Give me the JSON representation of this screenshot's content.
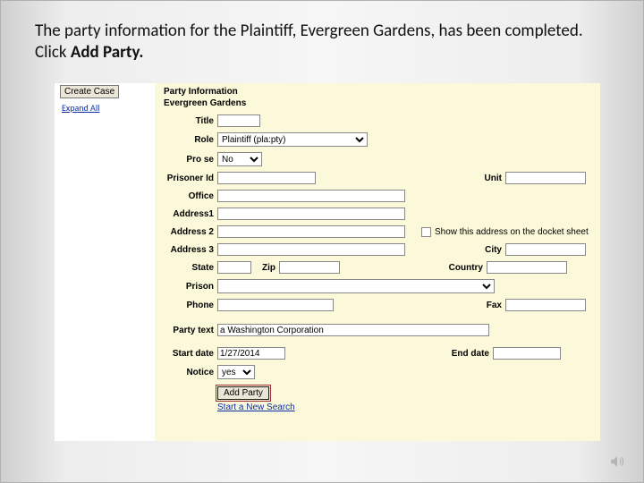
{
  "caption": {
    "text_a": "The party information for the Plaintiff, Evergreen Gardens, has been completed.  Click ",
    "text_b": "Add Party."
  },
  "sidebar": {
    "create_case": "Create Case",
    "expand_all": "Expand All"
  },
  "heading": {
    "line1": "Party Information",
    "line2": "Evergreen Gardens"
  },
  "labels": {
    "title": "Title",
    "role": "Role",
    "prose": "Pro se",
    "prisoner_id": "Prisoner Id",
    "unit": "Unit",
    "office": "Office",
    "address1": "Address1",
    "address2": "Address 2",
    "address3": "Address 3",
    "show_docket": "Show this address on the docket sheet",
    "city": "City",
    "state": "State",
    "zip": "Zip",
    "country": "Country",
    "prison": "Prison",
    "phone": "Phone",
    "fax": "Fax",
    "party_text": "Party text",
    "start_date": "Start date",
    "end_date": "End date",
    "notice": "Notice"
  },
  "values": {
    "title": "",
    "role": "Plaintiff (pla:pty)",
    "prose": "No",
    "prisoner_id": "",
    "unit": "",
    "office": "",
    "address1": "",
    "address2": "",
    "address3": "",
    "city": "",
    "state": "",
    "zip": "",
    "country": "",
    "prison": "",
    "phone": "",
    "fax": "",
    "party_text": "a Washington Corporation",
    "start_date": "1/27/2014",
    "end_date": "",
    "notice": "yes"
  },
  "buttons": {
    "add_party": "Add Party",
    "start_new": "Start a New Search"
  }
}
